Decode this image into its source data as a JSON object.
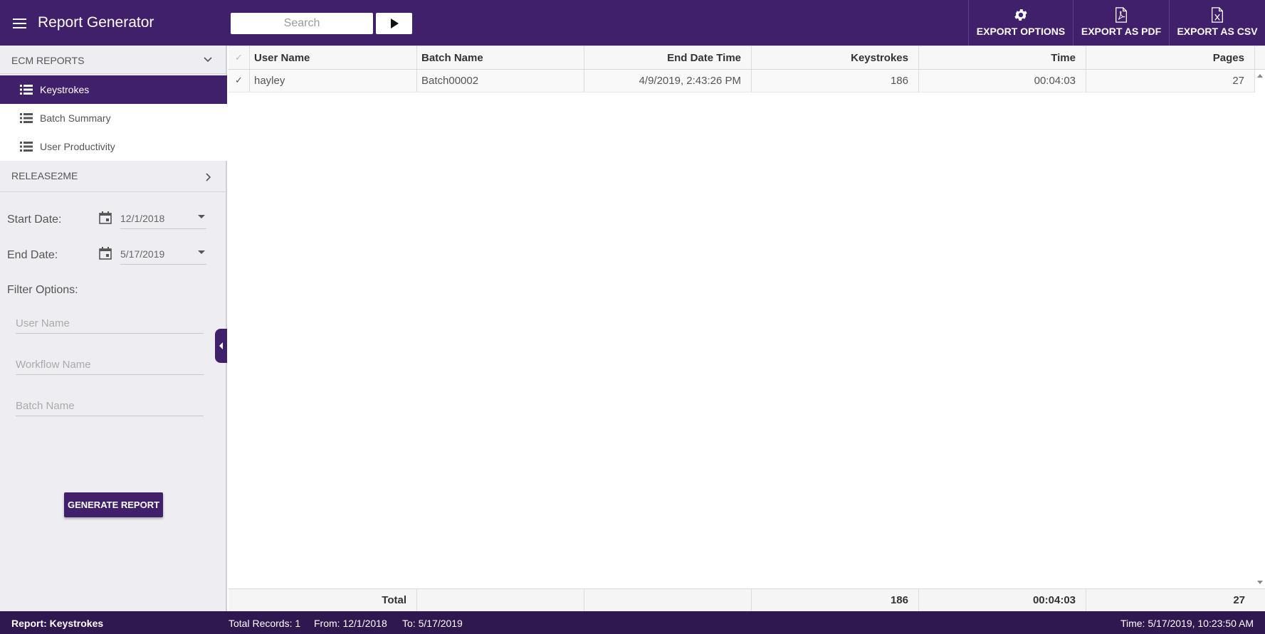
{
  "app": {
    "title": "Report Generator"
  },
  "search": {
    "placeholder": "Search"
  },
  "toolbar": {
    "export_options": "EXPORT OPTIONS",
    "export_pdf": "EXPORT AS PDF",
    "export_csv": "EXPORT AS CSV"
  },
  "sidebar": {
    "sections": [
      {
        "label": "ECM REPORTS",
        "expanded": true
      },
      {
        "label": "RELEASE2ME",
        "expanded": false
      }
    ],
    "items": [
      {
        "label": "Keystrokes",
        "active": true
      },
      {
        "label": "Batch Summary",
        "active": false
      },
      {
        "label": "User Productivity",
        "active": false
      }
    ],
    "start_date_label": "Start Date:",
    "start_date_value": "12/1/2018",
    "end_date_label": "End Date:",
    "end_date_value": "5/17/2019",
    "filter_label": "Filter Options:",
    "filters": [
      {
        "placeholder": "User Name"
      },
      {
        "placeholder": "Workflow Name"
      },
      {
        "placeholder": "Batch Name"
      }
    ],
    "generate_label": "GENERATE REPORT"
  },
  "grid": {
    "columns": [
      "User Name",
      "Batch Name",
      "End Date Time",
      "Keystrokes",
      "Time",
      "Pages"
    ],
    "rows": [
      [
        "hayley",
        "Batch00002",
        "4/9/2019, 2:43:26 PM",
        "186",
        "00:04:03",
        "27"
      ]
    ],
    "footer": {
      "label": "Total",
      "keystrokes": "186",
      "time": "00:04:03",
      "pages": "27"
    }
  },
  "status": {
    "report": "Report: Keystrokes",
    "total_records": "Total Records: 1",
    "from": "From: 12/1/2018",
    "to": "To: 5/17/2019",
    "time": "Time: 5/17/2019, 10:23:50 AM"
  },
  "colors": {
    "primary": "#41206b",
    "status_bar": "#2f174f"
  }
}
